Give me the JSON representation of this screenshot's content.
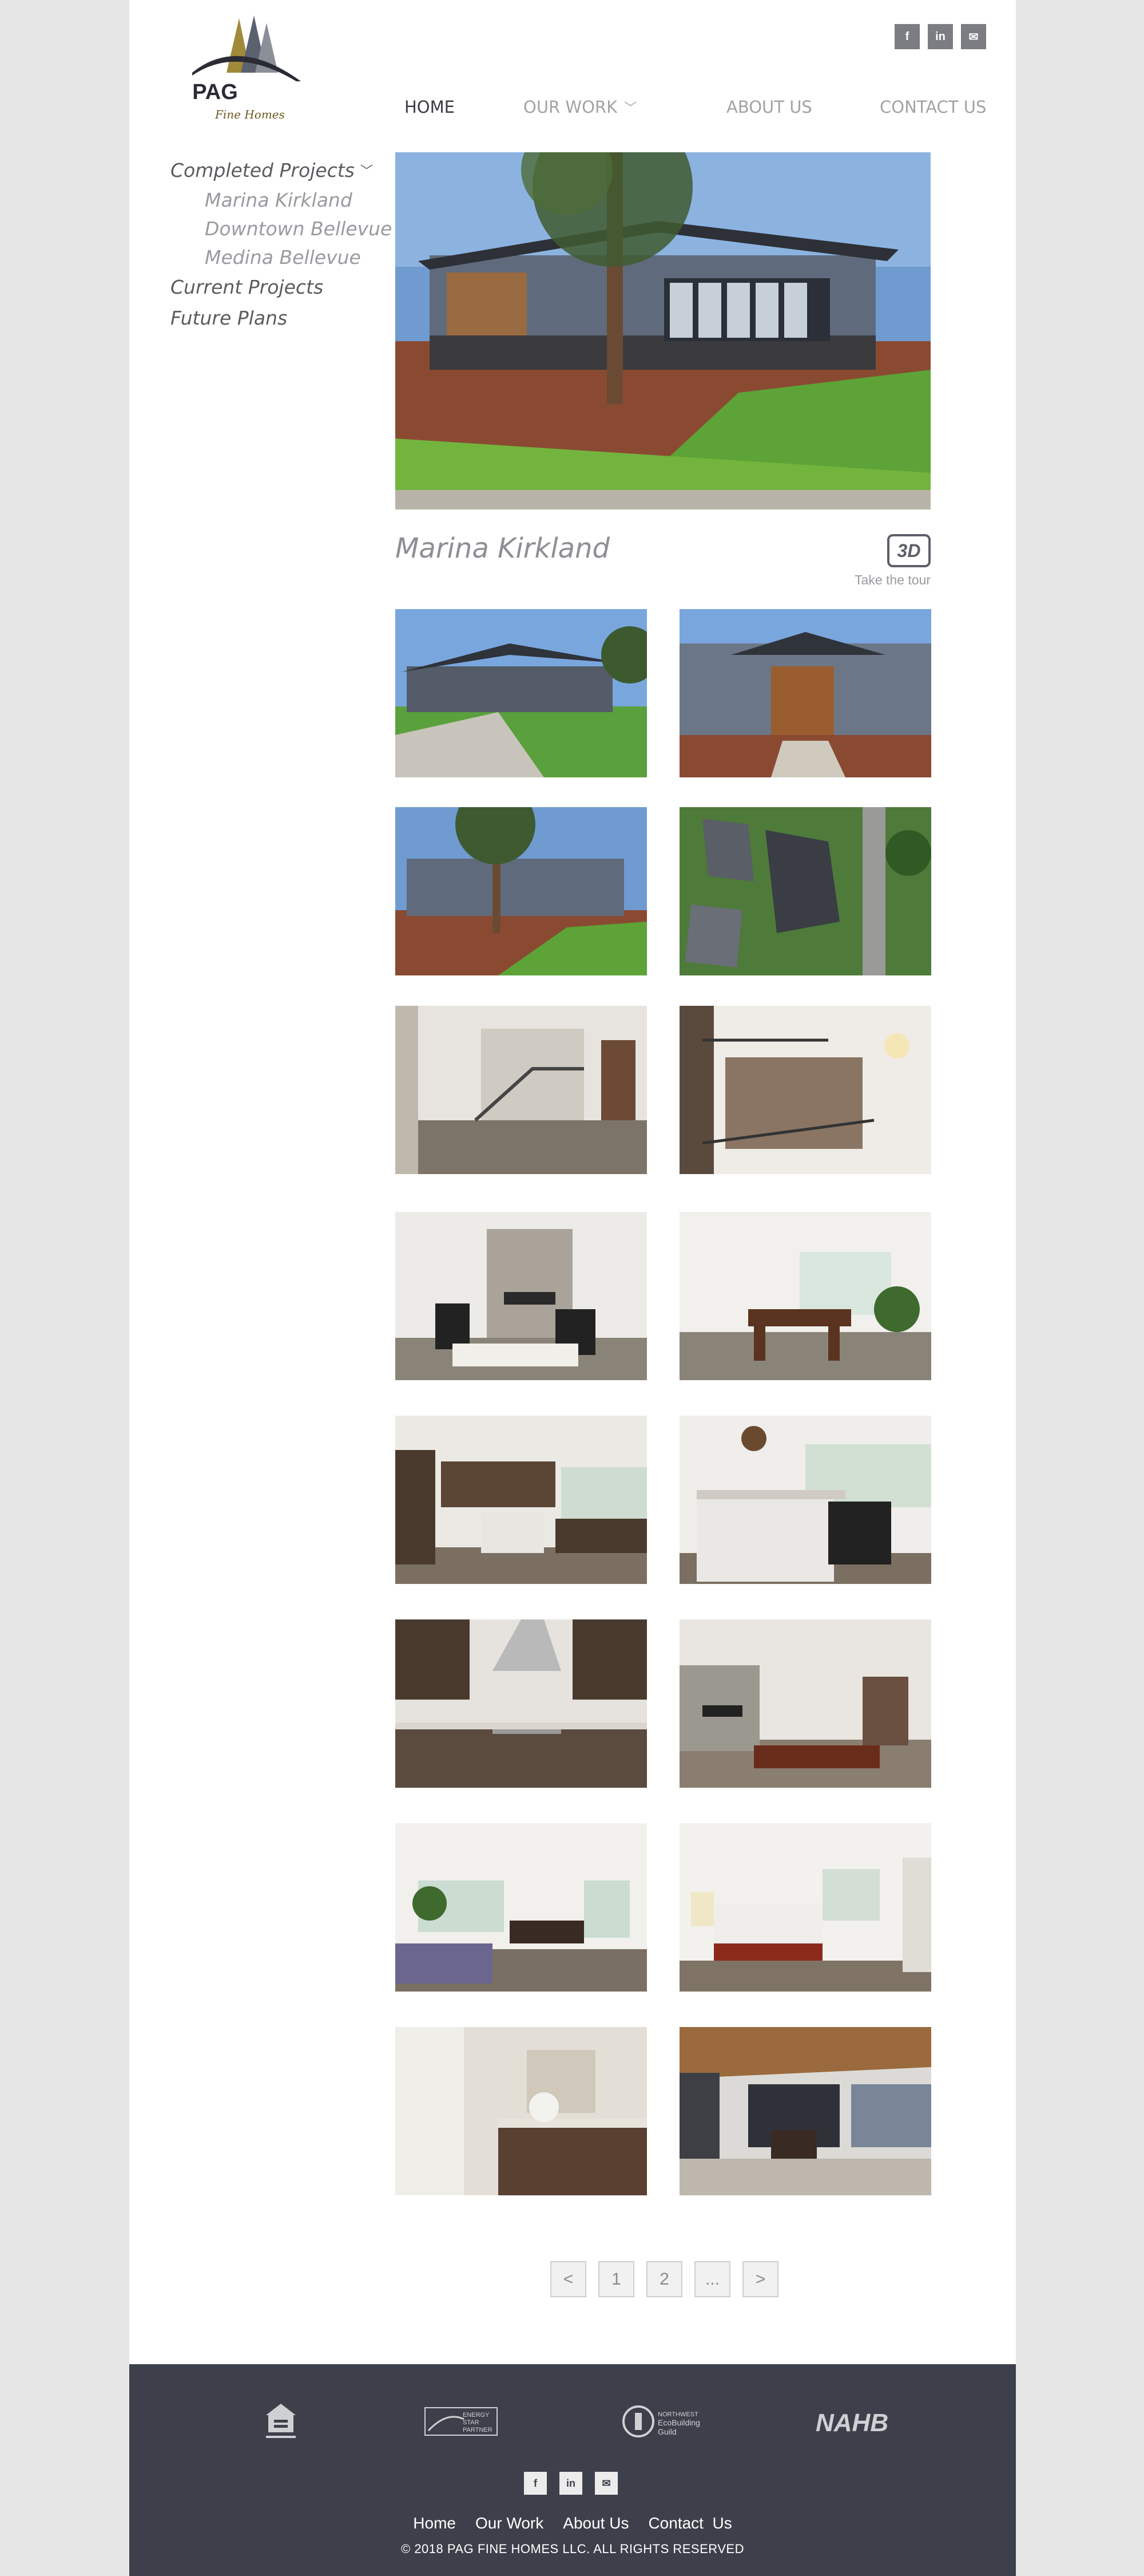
{
  "brand": {
    "name": "PAG",
    "tagline": "Fine Homes",
    "colors": {
      "gold": "#a08a3a",
      "navy": "#2b2b35",
      "gray": "#8b8f98"
    }
  },
  "social": [
    {
      "icon": "facebook-icon",
      "glyph": "f"
    },
    {
      "icon": "linkedin-icon",
      "glyph": "in"
    },
    {
      "icon": "email-icon",
      "glyph": "✉"
    }
  ],
  "nav": {
    "home": "HOME",
    "our_work": "OUR WORK",
    "about_us": "ABOUT US",
    "contact_us": "CONTACT US"
  },
  "sidebar": {
    "completed": "Completed Projects",
    "sub": [
      "Marina Kirkland",
      "Downtown Bellevue",
      "Medina Bellevue"
    ],
    "current": "Current Projects",
    "future": "Future Plans"
  },
  "project": {
    "title": "Marina Kirkland",
    "tour_badge": "3D",
    "tour_label": "Take the tour"
  },
  "gallery": [
    {
      "scene": "exterior-street"
    },
    {
      "scene": "exterior-entry"
    },
    {
      "scene": "exterior-garden"
    },
    {
      "scene": "aerial"
    },
    {
      "scene": "foyer-stairs"
    },
    {
      "scene": "stair-overlook"
    },
    {
      "scene": "living-fireplace"
    },
    {
      "scene": "dining"
    },
    {
      "scene": "kitchen-wide"
    },
    {
      "scene": "kitchen-island"
    },
    {
      "scene": "kitchen-range"
    },
    {
      "scene": "family-room"
    },
    {
      "scene": "bonus-room"
    },
    {
      "scene": "master-bedroom"
    },
    {
      "scene": "master-bath"
    },
    {
      "scene": "covered-patio"
    }
  ],
  "pagination": {
    "prev": "<",
    "pages": [
      "1",
      "2",
      "..."
    ],
    "next": ">"
  },
  "footer": {
    "badges": [
      "EQUAL HOUSING OPPORTUNITY",
      "ENERGY STAR PARTNER",
      "NORTHWEST EcoBuilding Guild",
      "NAHB"
    ],
    "links": [
      "Home",
      "Our Work",
      "About Us",
      "Contact  Us"
    ],
    "copyright": "© 2018 PAG FINE HOMES LLC. ALL RIGHTS RESERVED"
  }
}
